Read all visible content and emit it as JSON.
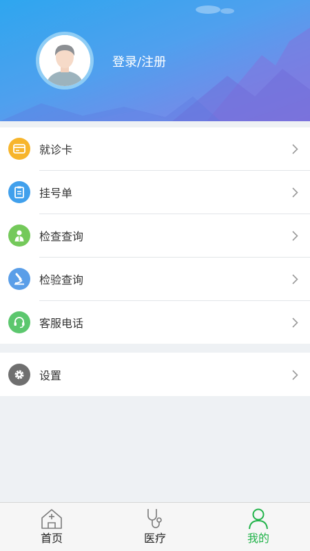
{
  "header": {
    "login_label": "登录/注册"
  },
  "menu": {
    "items": [
      {
        "label": "就诊卡",
        "icon": "card-icon",
        "color": "#f7b52c"
      },
      {
        "label": "挂号单",
        "icon": "clipboard-icon",
        "color": "#41a0ec"
      },
      {
        "label": "检查查询",
        "icon": "doctor-icon",
        "color": "#74c95a"
      },
      {
        "label": "检验查询",
        "icon": "microscope-icon",
        "color": "#5a9ee8"
      },
      {
        "label": "客服电话",
        "icon": "headset-icon",
        "color": "#5cc76e"
      }
    ],
    "settings": {
      "label": "设置",
      "icon": "gear-icon",
      "color": "#6f6f6f"
    }
  },
  "tabbar": {
    "tabs": [
      {
        "label": "首页",
        "icon": "hospital-home-icon"
      },
      {
        "label": "医疗",
        "icon": "stethoscope-icon"
      },
      {
        "label": "我的",
        "icon": "user-icon",
        "active": true
      }
    ],
    "active_color": "#21b34a"
  }
}
